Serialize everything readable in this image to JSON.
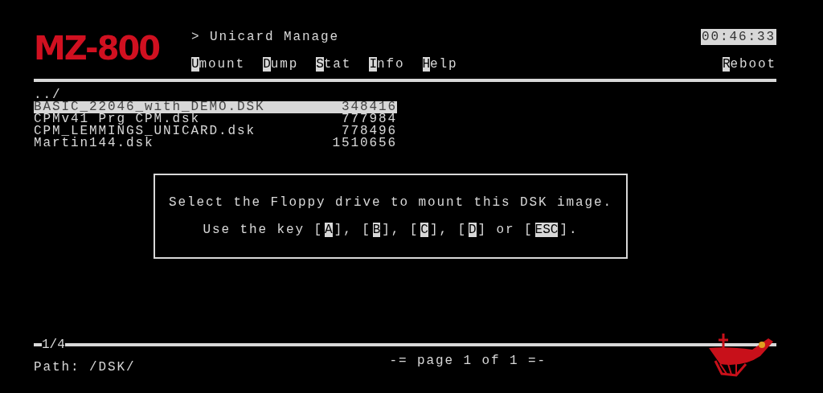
{
  "logo": "MZ-800",
  "title": "> Unicard Manage",
  "clock": "00:46:33",
  "menu": [
    {
      "key": "U",
      "rest": "mount"
    },
    {
      "key": "D",
      "rest": "ump"
    },
    {
      "key": "S",
      "rest": "tat"
    },
    {
      "key": "I",
      "rest": "nfo"
    },
    {
      "key": "H",
      "rest": "elp"
    }
  ],
  "reboot": {
    "key": "R",
    "rest": "eboot"
  },
  "parent": "../",
  "files": [
    {
      "name": "BASIC_22046_with_DEMO.DSK",
      "size": "348416",
      "selected": true
    },
    {
      "name": "CPMv41 Prg CPM.dsk",
      "size": "777984",
      "selected": false
    },
    {
      "name": "CPM_LEMMINGS_UNICARD.dsk",
      "size": "778496",
      "selected": false
    },
    {
      "name": "Martin144.dsk",
      "size": "1510656",
      "selected": false
    }
  ],
  "dialog": {
    "message": "Select the Floppy drive to mount this DSK image.",
    "keys_line": [
      {
        "kind": "text",
        "text": "Use the key ["
      },
      {
        "kind": "key",
        "text": "A"
      },
      {
        "kind": "text",
        "text": "], ["
      },
      {
        "kind": "key",
        "text": "B"
      },
      {
        "kind": "text",
        "text": "], ["
      },
      {
        "kind": "key",
        "text": "C"
      },
      {
        "kind": "text",
        "text": "], ["
      },
      {
        "kind": "key",
        "text": "D"
      },
      {
        "kind": "text",
        "text": "] or ["
      },
      {
        "kind": "key",
        "text": "ESC"
      },
      {
        "kind": "text",
        "text": "]."
      }
    ]
  },
  "counter": "1/4",
  "page": "-= page 1 of 1 =-",
  "path": "Path: /DSK/"
}
